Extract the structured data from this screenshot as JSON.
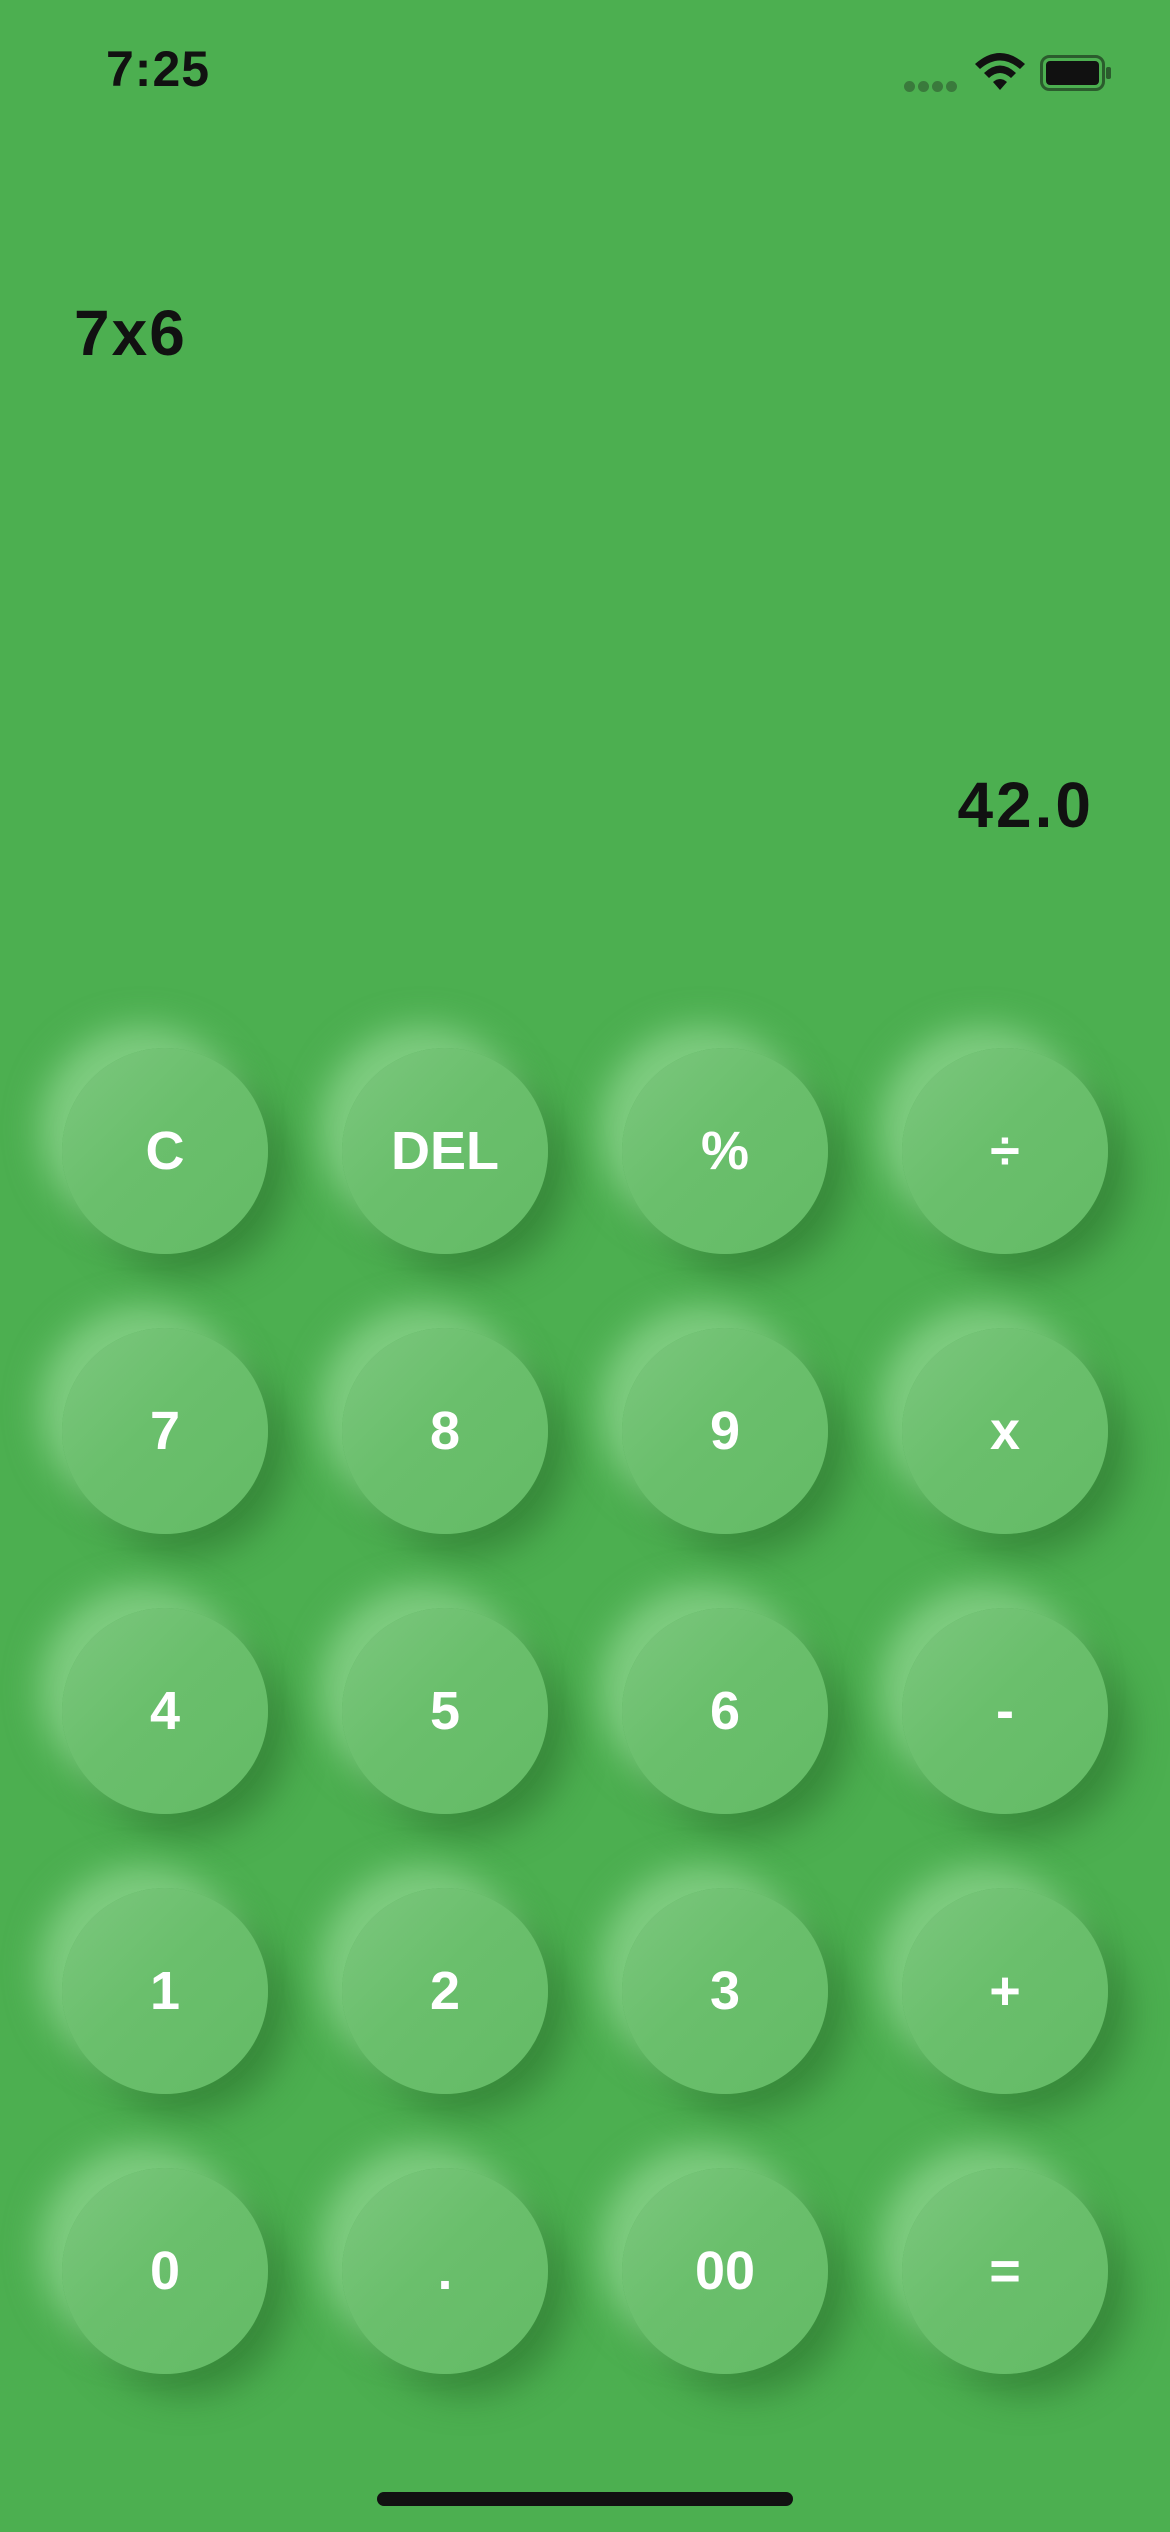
{
  "status_bar": {
    "time": "7:25"
  },
  "display": {
    "expression": "7x6",
    "result": "42.0"
  },
  "keypad": {
    "rows": [
      [
        "C",
        "DEL",
        "%",
        "÷"
      ],
      [
        "7",
        "8",
        "9",
        "x"
      ],
      [
        "4",
        "5",
        "6",
        "-"
      ],
      [
        "1",
        "2",
        "3",
        "+"
      ],
      [
        "0",
        ".",
        "00",
        "="
      ]
    ]
  },
  "colors": {
    "background": "#4caf50",
    "key": "#6abf6c",
    "key_text": "#ffffff",
    "display_text": "#111111"
  },
  "icons": {
    "signal": "cellular-signal-icon",
    "wifi": "wifi-icon",
    "battery": "battery-full-icon"
  }
}
